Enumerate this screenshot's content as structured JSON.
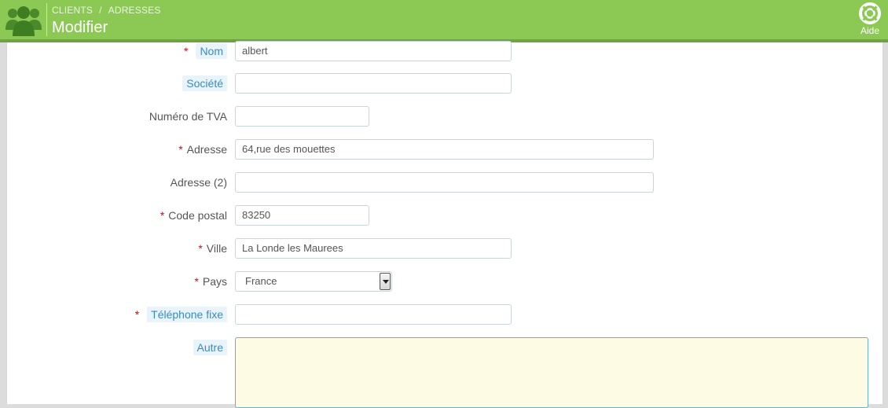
{
  "header": {
    "breadcrumb": [
      "CLIENTS",
      "ADRESSES"
    ],
    "breadcrumb_separator": "/",
    "title": "Modifier",
    "help_label": "Aide",
    "accent_color": "#8bc954"
  },
  "form": {
    "fields": [
      {
        "label": "Nom",
        "required": true,
        "hint": true,
        "value": "albert",
        "type": "text"
      },
      {
        "label": "Société",
        "required": false,
        "hint": true,
        "value": "",
        "type": "text"
      },
      {
        "label": "Numéro de TVA",
        "required": false,
        "hint": false,
        "value": "",
        "type": "text"
      },
      {
        "label": "Adresse",
        "required": true,
        "hint": false,
        "value": "64,rue des mouettes",
        "type": "text"
      },
      {
        "label": "Adresse (2)",
        "required": false,
        "hint": false,
        "value": "",
        "type": "text"
      },
      {
        "label": "Code postal",
        "required": true,
        "hint": false,
        "value": "83250",
        "type": "text"
      },
      {
        "label": "Ville",
        "required": true,
        "hint": false,
        "value": "La Londe les Maurees",
        "type": "text"
      },
      {
        "label": "Pays",
        "required": true,
        "hint": false,
        "value": "France",
        "type": "select"
      },
      {
        "label": "Téléphone fixe",
        "required": true,
        "hint": true,
        "value": "",
        "type": "text"
      },
      {
        "label": "Autre",
        "required": false,
        "hint": true,
        "value": "",
        "type": "textarea"
      }
    ],
    "required_marker": "*"
  },
  "icons": {
    "logo": "customers-group-icon",
    "help": "lifebuoy-icon"
  }
}
